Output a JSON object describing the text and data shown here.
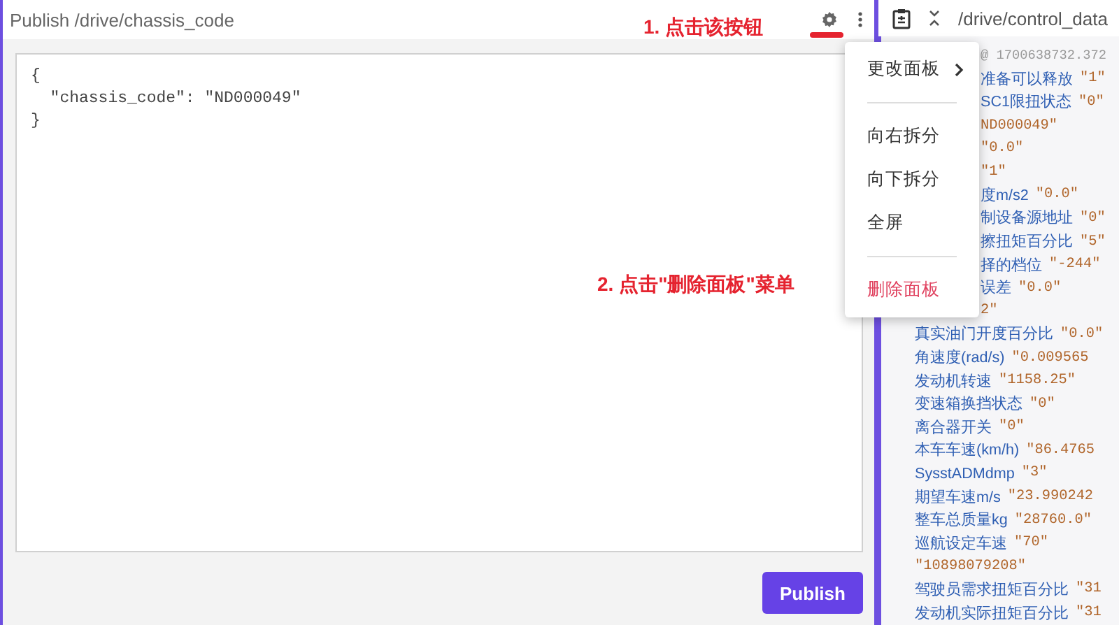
{
  "left_panel": {
    "title": "Publish /drive/chassis_code",
    "editor_lines": [
      "{",
      "  \"chassis_code\": \"ND000049\"",
      "}"
    ],
    "publish_button": "Publish"
  },
  "right_panel": {
    "title": "/drive/control_data",
    "timestamp": "@ 1700638732.372",
    "fields": [
      {
        "key": "准备可以释放",
        "value": "\"1\"",
        "clipped": true
      },
      {
        "key": "SC1限扭状态",
        "value": "\"0\"",
        "clipped": true
      },
      {
        "value": "ND000049\"",
        "clipped": true
      },
      {
        "value": "\"0.0\"",
        "clipped": true
      },
      {
        "value": "\"1\"",
        "clipped": true
      },
      {
        "key": "度m/s2",
        "value": "\"0.0\"",
        "clipped": true
      },
      {
        "key": "制设备源地址",
        "value": "\"0\"",
        "clipped": true
      },
      {
        "key": "擦扭矩百分比",
        "value": "\"5\"",
        "clipped": true
      },
      {
        "key": "择的档位",
        "value": "\"-244\"",
        "clipped": true
      },
      {
        "key": "误差",
        "value": "\"0.0\"",
        "clipped": true
      },
      {
        "value": "2\"",
        "clipped": true
      },
      {
        "key": "真实油门开度百分比",
        "value": "\"0.0\"",
        "clipped": false
      },
      {
        "key": "角速度(rad/s)",
        "value": "\"0.009565",
        "clipped": false
      },
      {
        "key": "发动机转速",
        "value": "\"1158.25\"",
        "clipped": false
      },
      {
        "key": "变速箱换挡状态",
        "value": "\"0\"",
        "clipped": false
      },
      {
        "key": "离合器开关",
        "value": "\"0\"",
        "clipped": false
      },
      {
        "key": "本车车速(km/h)",
        "value": "\"86.4765",
        "clipped": false
      },
      {
        "key": "SysstADMdmp",
        "value": "\"3\"",
        "clipped": false
      },
      {
        "key": "期望车速m/s",
        "value": "\"23.990242",
        "clipped": false
      },
      {
        "key": "整车总质量kg",
        "value": "\"28760.0\"",
        "clipped": false
      },
      {
        "key": "巡航设定车速",
        "value": "\"70\"",
        "clipped": false
      },
      {
        "value": "\"10898079208\"",
        "clipped": false
      },
      {
        "key": "驾驶员需求扭矩百分比",
        "value": "\"31",
        "clipped": false
      },
      {
        "key": "发动机实际扭矩百分比",
        "value": "\"31",
        "clipped": false
      }
    ]
  },
  "menu": {
    "items": [
      {
        "kind": "submenu",
        "label": "更改面板"
      },
      {
        "kind": "divider"
      },
      {
        "kind": "item",
        "label": "向右拆分"
      },
      {
        "kind": "item",
        "label": "向下拆分"
      },
      {
        "kind": "item",
        "label": "全屏"
      },
      {
        "kind": "divider"
      },
      {
        "kind": "danger",
        "label": "删除面板"
      }
    ]
  },
  "annotations": [
    {
      "label": "1. 点击该按钮",
      "underline": true
    },
    {
      "label": "2. 点击\"删除面板\"菜单",
      "underline": false
    }
  ]
}
